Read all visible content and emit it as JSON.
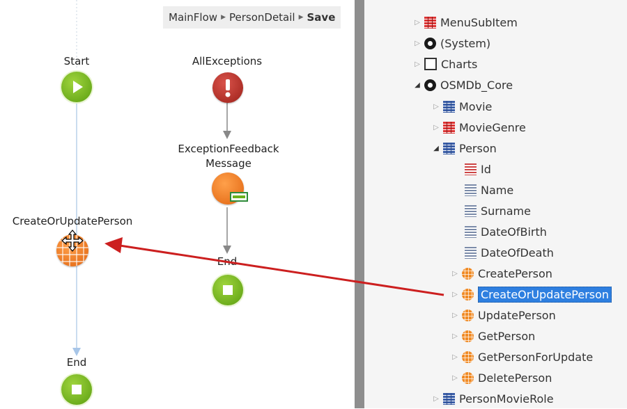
{
  "breadcrumb": {
    "items": [
      "MainFlow",
      "PersonDetail"
    ],
    "current": "Save"
  },
  "flow": {
    "start_label": "Start",
    "exceptions_label": "AllExceptions",
    "feedback_label": "ExceptionFeedback\nMessage",
    "end_label_middle": "End",
    "create_update_label": "CreateOrUpdatePerson",
    "end_label_bottom": "End"
  },
  "tree": {
    "items": [
      {
        "label": "MenuSubItem",
        "icon": "entity-red-icon"
      },
      {
        "label": "(System)",
        "icon": "module-icon"
      },
      {
        "label": "Charts",
        "icon": "chart-icon"
      },
      {
        "label": "OSMDb_Core",
        "icon": "module-icon"
      },
      {
        "label": "Movie",
        "icon": "entity-icon"
      },
      {
        "label": "MovieGenre",
        "icon": "entity-red-icon"
      },
      {
        "label": "Person",
        "icon": "entity-icon"
      },
      {
        "label": "Id",
        "icon": "attribute-key-icon"
      },
      {
        "label": "Name",
        "icon": "attribute-icon"
      },
      {
        "label": "Surname",
        "icon": "attribute-icon"
      },
      {
        "label": "DateOfBirth",
        "icon": "attribute-icon"
      },
      {
        "label": "DateOfDeath",
        "icon": "attribute-icon"
      },
      {
        "label": "CreatePerson",
        "icon": "entity-action-icon"
      },
      {
        "label": "CreateOrUpdatePerson",
        "icon": "entity-action-icon",
        "selected": true
      },
      {
        "label": "UpdatePerson",
        "icon": "entity-action-icon"
      },
      {
        "label": "GetPerson",
        "icon": "entity-action-icon"
      },
      {
        "label": "GetPersonForUpdate",
        "icon": "entity-action-icon"
      },
      {
        "label": "DeletePerson",
        "icon": "entity-action-icon"
      },
      {
        "label": "PersonMovieRole",
        "icon": "entity-icon"
      }
    ]
  },
  "colors": {
    "selection": "#2e7fe0",
    "drag_arrow": "#cc1f1f",
    "flow_node_green": "#6bb21c",
    "flow_node_red": "#b8342b",
    "flow_node_orange": "#f08a24"
  }
}
